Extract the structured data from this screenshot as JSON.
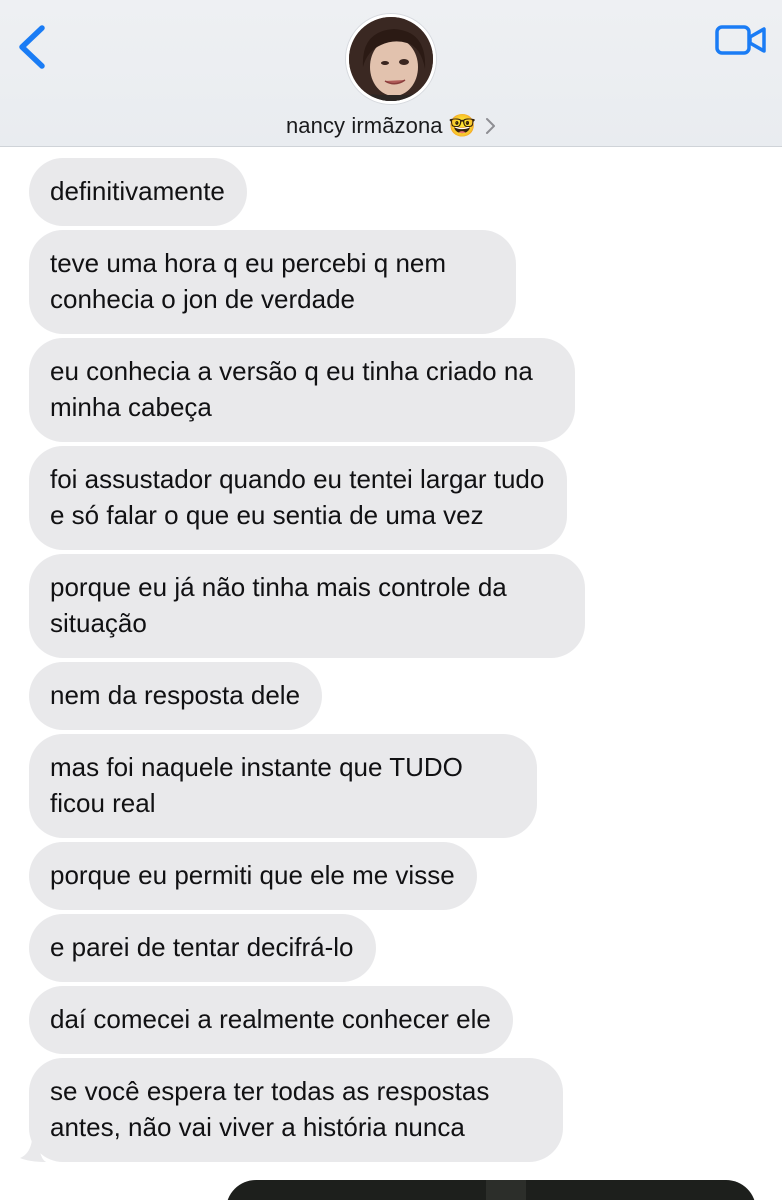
{
  "header": {
    "contact_name": "nancy irmãzona",
    "contact_emoji": "🤓",
    "back_icon": "chevron-left-icon",
    "video_icon": "video-camera-icon",
    "accent_color": "#1a7cf5"
  },
  "messages": [
    {
      "text": "definitivamente"
    },
    {
      "text": "teve uma hora q eu percebi q nem conhecia o jon de verdade"
    },
    {
      "text": "eu conhecia a versão q eu tinha criado na minha cabeça"
    },
    {
      "text": "foi assustador quando eu tentei largar tudo e só falar o que eu sentia de uma vez"
    },
    {
      "text": "porque eu já não tinha mais controle da situação"
    },
    {
      "text": "nem da resposta dele"
    },
    {
      "text": "mas foi naquele instante que TUDO ficou real"
    },
    {
      "text": "porque eu permiti que ele me visse"
    },
    {
      "text": "e parei de tentar decifrá-lo"
    },
    {
      "text": "daí comecei a realmente conhecer ele"
    },
    {
      "text": "se você espera ter todas as respostas antes, não vai viver a história nunca"
    }
  ],
  "bubble_color": "#e9e9eb"
}
